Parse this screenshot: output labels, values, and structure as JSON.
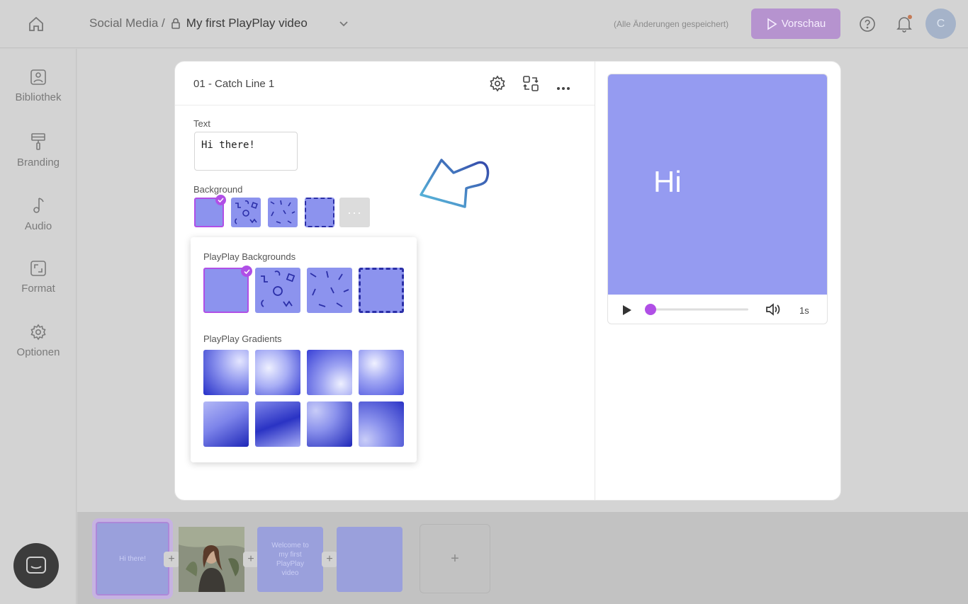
{
  "topbar": {
    "breadcrumb_parent": "Social Media /",
    "project_title": "My first PlayPlay video",
    "save_status": "(Alle Änderungen gespeichert)",
    "preview_label": "Vorschau",
    "avatar_initial": "C"
  },
  "sidebar": {
    "items": [
      {
        "label": "Bibliothek",
        "icon": "image-icon"
      },
      {
        "label": "Branding",
        "icon": "paint-roller-icon"
      },
      {
        "label": "Audio",
        "icon": "music-note-icon"
      },
      {
        "label": "Format",
        "icon": "resize-icon"
      },
      {
        "label": "Optionen",
        "icon": "gear-icon"
      }
    ]
  },
  "editor": {
    "scene_title": "01 - Catch Line 1",
    "text_label": "Text",
    "text_value": "Hi there!",
    "background_label": "Background",
    "more_label": "···"
  },
  "dropdown": {
    "backgrounds_title": "PlayPlay Backgrounds",
    "gradients_title": "PlayPlay Gradients"
  },
  "preview": {
    "screen_text": "Hi",
    "time": "1s",
    "progress": 0
  },
  "timeline": {
    "clips": [
      {
        "label": "Hi there!"
      },
      {
        "label": ""
      },
      {
        "label": "Welcome to my first PlayPlay video"
      },
      {
        "label": ""
      }
    ],
    "add_label": "+"
  },
  "colors": {
    "accent": "#b04fe6",
    "preview_bg": "#959bf1",
    "thumb_bg": "#8c93ee",
    "pattern": "#2b2fa8"
  }
}
